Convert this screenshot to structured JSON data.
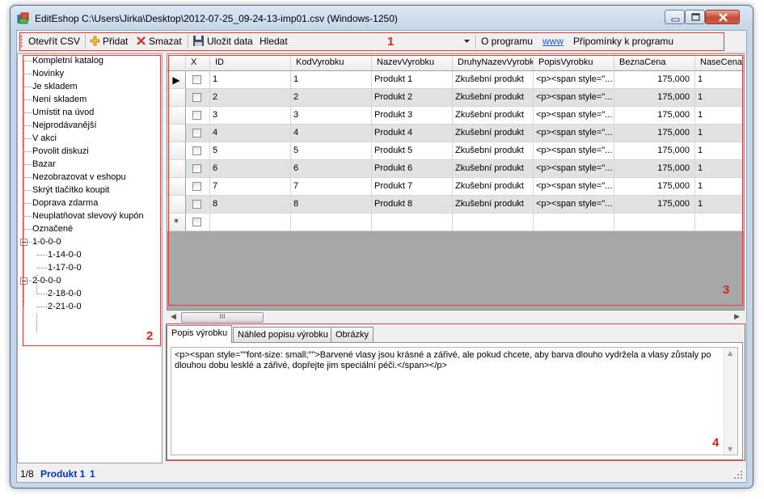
{
  "window": {
    "title": "EditEshop C:\\Users\\Jirka\\Desktop\\2012-07-25_09-24-13-imp01.csv  (Windows-1250)",
    "controls": [
      "minimize-icon",
      "maximize-icon",
      "close-icon"
    ]
  },
  "toolbar": {
    "open_csv": "Otevřít CSV",
    "add": "Přidat",
    "delete": "Smazat",
    "save": "Uložit data",
    "search": "Hledat",
    "about": "O programu",
    "www": "www",
    "feedback": "Připomínky k programu",
    "icons": {
      "add": "plus-icon",
      "delete": "x-icon",
      "save": "floppy-disk-icon",
      "dropdown": "dropdown-arrow-icon"
    }
  },
  "annotations": [
    "1",
    "2",
    "3",
    "4"
  ],
  "annotation_color": "#e33a3a",
  "tree": {
    "items": [
      "Kompletní katalog",
      "Novinky",
      "Je skladem",
      "Není skladem",
      "Umístit na úvod",
      "Nejprodávanější",
      "V akci",
      "Povolit diskuzi",
      "Bazar",
      "Nezobrazovat v eshopu",
      "Skrýt tlačítko koupit",
      "Doprava zdarma",
      "Neuplatňovat slevový kupón",
      "Označené",
      "1-0-0-0",
      "1-14-0-0",
      "1-17-0-0",
      "2-0-0-0",
      "2-18-0-0",
      "2-21-0-0"
    ]
  },
  "grid": {
    "columns": [
      "X",
      "ID",
      "KodVyrobku",
      "NazevVyrobku",
      "DruhyNazevVyrobk",
      "PopisVyrobku",
      "BeznaCena",
      "NaseCena"
    ],
    "rows": [
      {
        "id": "1",
        "kod": "1",
        "nazev": "Produkt 1",
        "druhy": "Zkušební produkt",
        "popis": "<p><span style=\"...",
        "cena": "175,000",
        "nase": "1"
      },
      {
        "id": "2",
        "kod": "2",
        "nazev": "Produkt 2",
        "druhy": "Zkušební produkt",
        "popis": "<p><span style=\"...",
        "cena": "175,000",
        "nase": "1"
      },
      {
        "id": "3",
        "kod": "3",
        "nazev": "Produkt 3",
        "druhy": "Zkušební produkt",
        "popis": "<p><span style=\"...",
        "cena": "175,000",
        "nase": "1"
      },
      {
        "id": "4",
        "kod": "4",
        "nazev": "Produkt 4",
        "druhy": "Zkušební produkt",
        "popis": "<p><span style=\"...",
        "cena": "175,000",
        "nase": "1"
      },
      {
        "id": "5",
        "kod": "5",
        "nazev": "Produkt 5",
        "druhy": "Zkušební produkt",
        "popis": "<p><span style=\"...",
        "cena": "175,000",
        "nase": "1"
      },
      {
        "id": "6",
        "kod": "6",
        "nazev": "Produkt 6",
        "druhy": "Zkušební produkt",
        "popis": "<p><span style=\"...",
        "cena": "175,000",
        "nase": "1"
      },
      {
        "id": "7",
        "kod": "7",
        "nazev": "Produkt 7",
        "druhy": "Zkušební produkt",
        "popis": "<p><span style=\"...",
        "cena": "175,000",
        "nase": "1"
      },
      {
        "id": "8",
        "kod": "8",
        "nazev": "Produkt 8",
        "druhy": "Zkušební produkt",
        "popis": "<p><span style=\"...",
        "cena": "175,000",
        "nase": "1"
      }
    ],
    "current_row_marker": "▶",
    "new_row_marker": "*",
    "alt_row_color": "#e2e2e2"
  },
  "tabs": [
    "Popis výrobku",
    "Náhled popisu výrobku",
    "Obrázky"
  ],
  "description": "<p><span style=\"\"font-size: small;\"\">Barvené vlasy jsou krásné a zářivé, ale pokud chcete, aby barva dlouho vydržela a vlasy zůstaly po dlouhou dobu lesklé a zářivé, dopřejte jim speciální péči.</span></p>",
  "status": {
    "position": "1/8",
    "product": "Produkt 1",
    "id": "1",
    "link_color": "#0033cc"
  }
}
